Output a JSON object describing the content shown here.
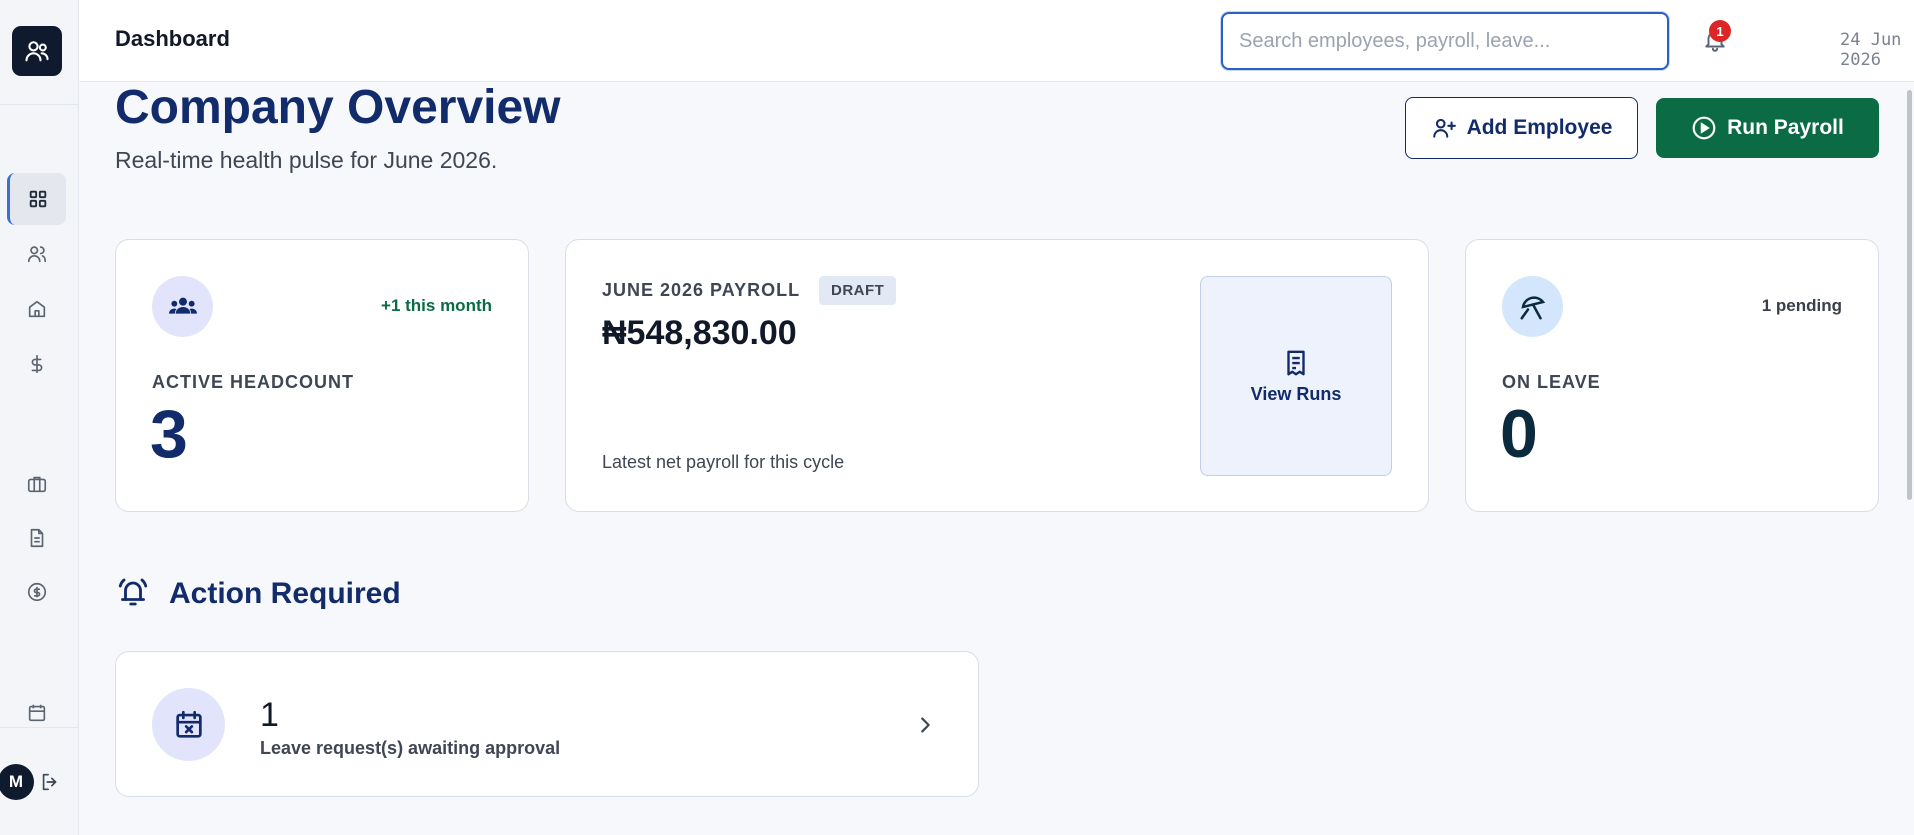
{
  "header": {
    "title": "Dashboard",
    "search_placeholder": "Search employees, payroll, leave...",
    "notifications_count": "1",
    "date": "24 Jun 2026"
  },
  "sidebar": {
    "items": [
      {
        "icon": "grid-icon",
        "active": true
      },
      {
        "icon": "users-icon",
        "active": false
      },
      {
        "icon": "home-icon",
        "active": false
      },
      {
        "icon": "dollar-icon",
        "active": false
      },
      {
        "icon": "briefcase-icon",
        "active": false
      },
      {
        "icon": "document-icon",
        "active": false
      },
      {
        "icon": "coin-icon",
        "active": false
      },
      {
        "icon": "calendar-icon",
        "active": false
      }
    ],
    "user_initial": "M"
  },
  "overview": {
    "title": "Company Overview",
    "subtitle": "Real-time health pulse for June 2026.",
    "add_employee_label": "Add Employee",
    "run_payroll_label": "Run Payroll"
  },
  "cards": {
    "headcount": {
      "trend": "+1 this month",
      "label": "ACTIVE HEADCOUNT",
      "value": "3"
    },
    "payroll": {
      "label": "JUNE 2026 PAYROLL",
      "status": "DRAFT",
      "amount": "₦548,830.00",
      "note": "Latest net payroll for this cycle",
      "view_runs_label": "View Runs"
    },
    "leave": {
      "pending": "1 pending",
      "label": "ON LEAVE",
      "value": "0"
    }
  },
  "action_required": {
    "title": "Action Required",
    "items": [
      {
        "count": "1",
        "text": "Leave request(s) awaiting approval"
      }
    ]
  },
  "colors": {
    "brand_navy": "#122b6b",
    "brand_green": "#0a6b45",
    "alert_red": "#dc2626"
  }
}
